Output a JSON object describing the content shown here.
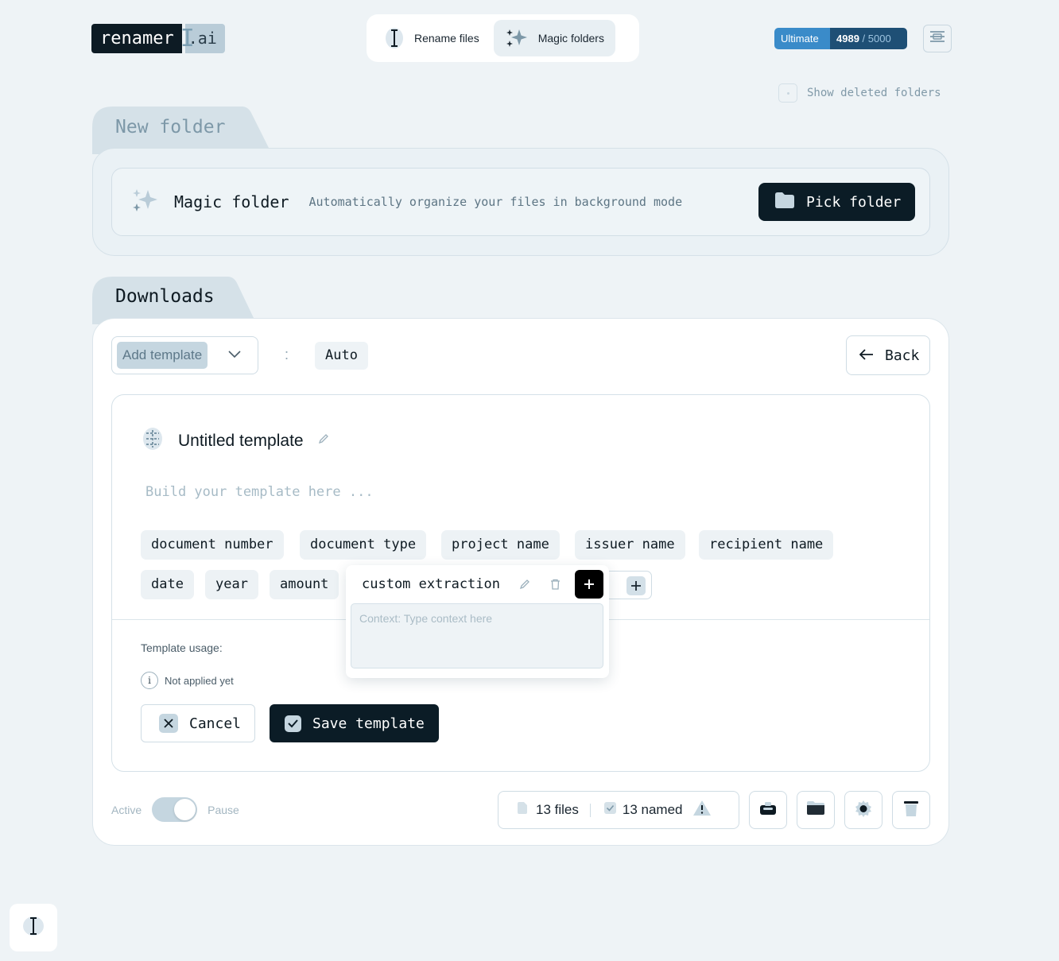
{
  "header": {
    "logo_main": "renamer",
    "logo_suffix": ".ai",
    "modes": [
      {
        "label": "Rename files",
        "icon": "text-cursor-icon",
        "active": false
      },
      {
        "label": "Magic folders",
        "icon": "sparkles-icon",
        "active": true
      }
    ],
    "plan": {
      "name": "Ultimate",
      "used": "4989",
      "total": "/ 5000"
    },
    "menu_icon": "menu-icon"
  },
  "show_deleted_label": "Show deleted folders",
  "new_folder": {
    "tab_title": "New folder",
    "magic_title": "Magic folder",
    "magic_desc": "Automatically organize your files in background mode",
    "pick_label": "Pick folder"
  },
  "downloads": {
    "tab_title": "Downloads",
    "template_select_label": "Add template",
    "separator": ":",
    "auto_label": "Auto",
    "back_label": "Back",
    "template": {
      "name": "Untitled template",
      "placeholder": "Build your template here ...",
      "chips_row1": [
        "document number",
        "document type",
        "project name",
        "issuer name",
        "recipient name"
      ],
      "chips_row2": [
        "date",
        "year",
        "amount"
      ],
      "usage_label": "Template usage:",
      "usage_status": "Not applied yet",
      "cancel_label": "Cancel",
      "save_label": "Save template"
    },
    "popover": {
      "label": "custom extraction",
      "context_placeholder": "Context: Type context here"
    },
    "footer": {
      "active_label": "Active",
      "pause_label": "Pause",
      "files_count": "13 files",
      "named_count": "13 named"
    }
  },
  "colors": {
    "background": "#eef3f6",
    "dark": "#0b1c26",
    "accent": "#3a8bc9",
    "chip": "#edf2f5"
  }
}
